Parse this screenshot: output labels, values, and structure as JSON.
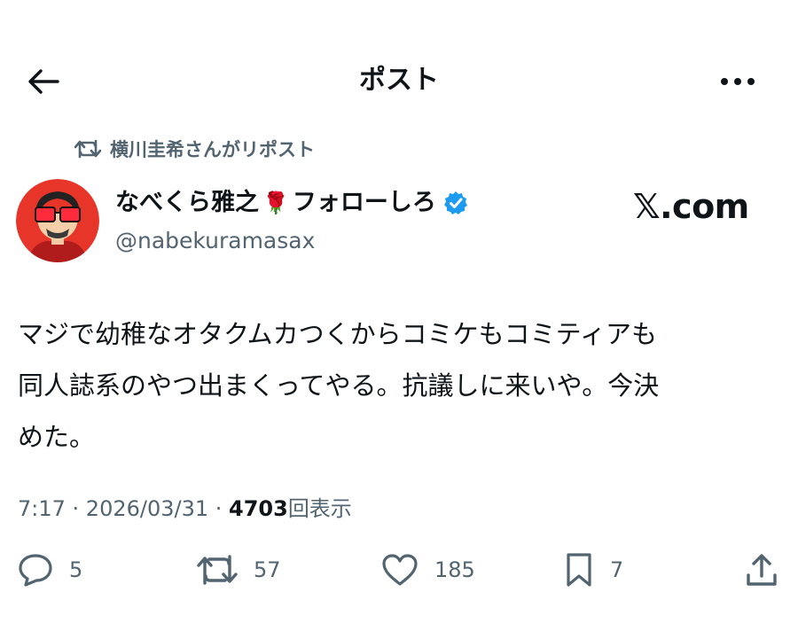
{
  "header": {
    "title": "ポスト"
  },
  "repost_context": {
    "text": "横川圭希さんがリポスト"
  },
  "author": {
    "display_name": "なべくら雅之🌹フォローしろ",
    "name_main": "なべくら雅之",
    "name_emoji": "🌹",
    "name_suffix": "フォローしろ",
    "handle": "@nabekuramasax",
    "verified": true
  },
  "source_badge": "𝕏.com",
  "post": {
    "lines": [
      "マジで幼稚なオタクムカつくからコミケもコミティアも",
      "同人誌系のやつ出まくってやる。抗議しに来いや。今決",
      "めた。"
    ]
  },
  "meta": {
    "time": "7:17",
    "date": "2026/03/31",
    "separator": " · ",
    "views_count": "4703",
    "views_label": "回表示"
  },
  "actions": {
    "reply_count": "5",
    "repost_count": "57",
    "like_count": "185",
    "bookmark_count": "7"
  },
  "colors": {
    "text": "#0f1419",
    "secondary": "#536471",
    "verified": "#1d9bf0"
  }
}
